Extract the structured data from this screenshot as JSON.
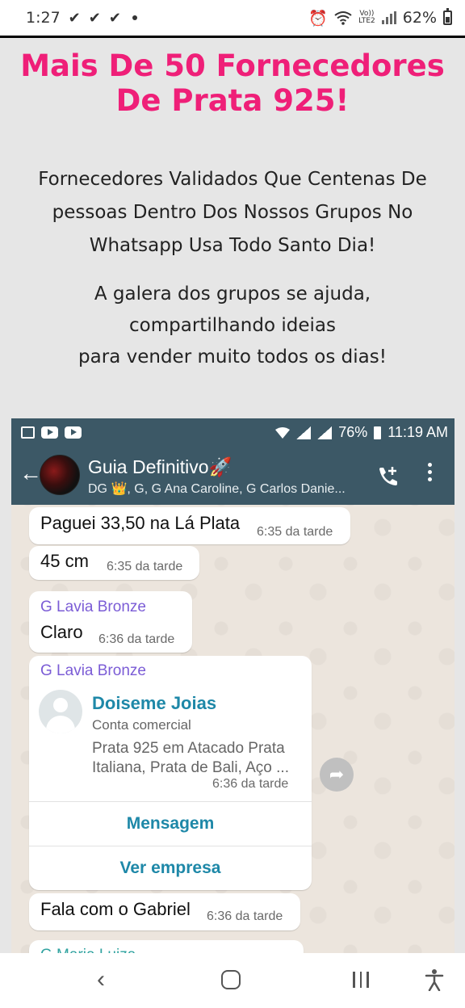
{
  "status_bar": {
    "time": "1:27",
    "checks": [
      "✔",
      "✔",
      "✔"
    ],
    "volte": "Vo))",
    "lte": "LTE2",
    "battery": "62%"
  },
  "promo": {
    "headline": "Mais De 50 Fornecedores De Prata 925!",
    "paragraph1": "Fornecedores Validados Que Centenas De pessoas Dentro Dos Nossos Grupos No Whatsapp Usa Todo Santo Dia!",
    "paragraph2_lines": [
      "A galera dos grupos se ajuda,",
      "compartilhando ideias",
      "para vender muito todos os dias!"
    ],
    "headline_color": "#ef1f78"
  },
  "chat_screenshot": {
    "status": {
      "battery": "76%",
      "time": "11:19 AM"
    },
    "header": {
      "back_icon": "arrow-left-icon",
      "group_name": "Guia Definitivo🚀",
      "members": "DG 👑, G, G Ana Caroline, G Carlos Danie..."
    },
    "messages": [
      {
        "text": "Paguei 33,50 na Lá Plata",
        "time": "6:35 da tarde"
      },
      {
        "text": "45 cm",
        "time": "6:35 da tarde"
      },
      {
        "sender": "G Lavia Bronze",
        "text": "Claro",
        "time": "6:36 da tarde"
      },
      {
        "sender": "G Lavia Bronze",
        "card": {
          "name": "Doiseme Joias",
          "type": "Conta comercial",
          "description": "Prata 925 em Atacado Prata Italiana, Prata de Bali, Aço ...",
          "time": "6:36 da tarde",
          "button_message": "Mensagem",
          "button_business": "Ver empresa"
        }
      },
      {
        "text": "Fala com o Gabriel",
        "time": "6:36 da tarde"
      },
      {
        "sender": "G Maria Luiza"
      }
    ],
    "header_color": "#3c5866",
    "chat_bg": "#ece5dd"
  },
  "nav": {
    "icons": [
      "back-icon",
      "home-icon",
      "recents-icon",
      "accessibility-icon"
    ]
  }
}
